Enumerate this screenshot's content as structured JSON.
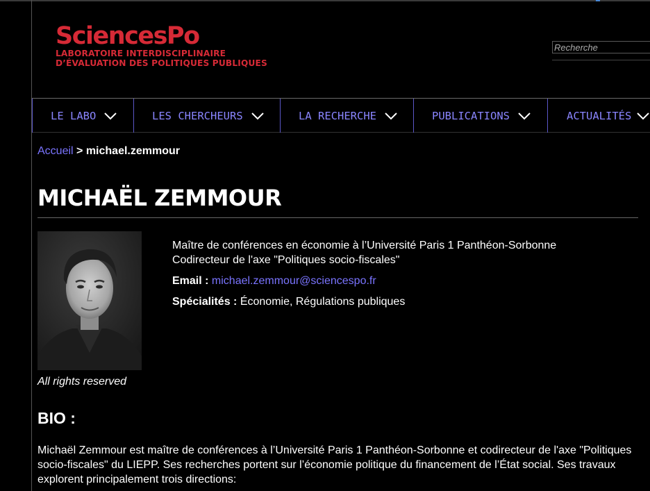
{
  "header": {
    "logo_main": "SciencesPo",
    "logo_line1": "LABORATOIRE INTERDISCIPLINAIRE",
    "logo_line2": "D’ÉVALUATION DES POLITIQUES PUBLIQUES",
    "search_placeholder": "Recherche"
  },
  "nav": {
    "items": [
      {
        "label": "LE LABO"
      },
      {
        "label": "LES CHERCHEURS"
      },
      {
        "label": "LA RECHERCHE"
      },
      {
        "label": "PUBLICATIONS"
      },
      {
        "label": "ACTUALITÉS"
      }
    ]
  },
  "breadcrumb": {
    "home": "Accueil",
    "separator": ">",
    "current": "michael.zemmour"
  },
  "profile": {
    "name": "MICHAËL ZEMMOUR",
    "photo_caption": "All rights reserved",
    "position_line1": "Maître de conférences en économie à l’Université Paris 1 Panthéon-Sorbonne",
    "position_line2": "Codirecteur de l'axe \"Politiques socio-fiscales\"",
    "email_label": "Email :",
    "email": "michael.zemmour@sciencespo.fr",
    "specialties_label": "Spécialités :",
    "specialties": "Économie, Régulations publiques"
  },
  "bio": {
    "title": "BIO :",
    "text": "Michaël Zemmour est maître de conférences à l’Université Paris 1 Panthéon-Sorbonne et codirecteur de l'axe \"Politiques socio-fiscales\" du LIEPP. Ses recherches portent sur l’économie politique du financement de l’État social. Ses travaux explorent principalement trois directions:"
  },
  "colors": {
    "brand_red": "#d62a36",
    "link_purple": "#7a74ff",
    "nav_text": "#8a85ff",
    "nav_border": "#5b57c8",
    "background": "#000000"
  },
  "icons": {
    "nav_chevron": "chevron-down-icon"
  }
}
